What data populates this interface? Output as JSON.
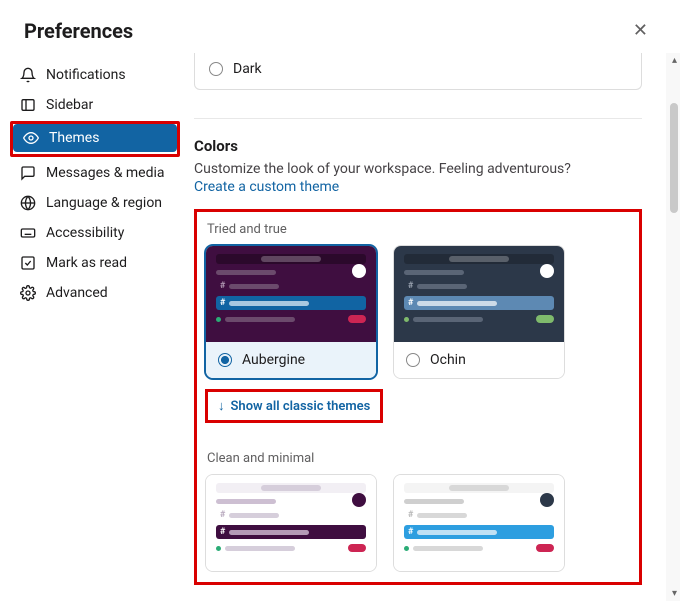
{
  "header": {
    "title": "Preferences"
  },
  "sidebar": {
    "items": [
      {
        "label": "Notifications"
      },
      {
        "label": "Sidebar"
      },
      {
        "label": "Themes"
      },
      {
        "label": "Messages & media"
      },
      {
        "label": "Language & region"
      },
      {
        "label": "Accessibility"
      },
      {
        "label": "Mark as read"
      },
      {
        "label": "Advanced"
      }
    ]
  },
  "colorMode": {
    "darkLabel": "Dark"
  },
  "colors": {
    "heading": "Colors",
    "description": "Customize the look of your workspace. Feeling adventurous?",
    "customLink": "Create a custom theme"
  },
  "groups": {
    "triedTrue": "Tried and true",
    "cleanMinimal": "Clean and minimal"
  },
  "themes": {
    "aubergine": {
      "name": "Aubergine"
    },
    "ochin": {
      "name": "Ochin"
    }
  },
  "showAllClassic": "Show all classic themes"
}
